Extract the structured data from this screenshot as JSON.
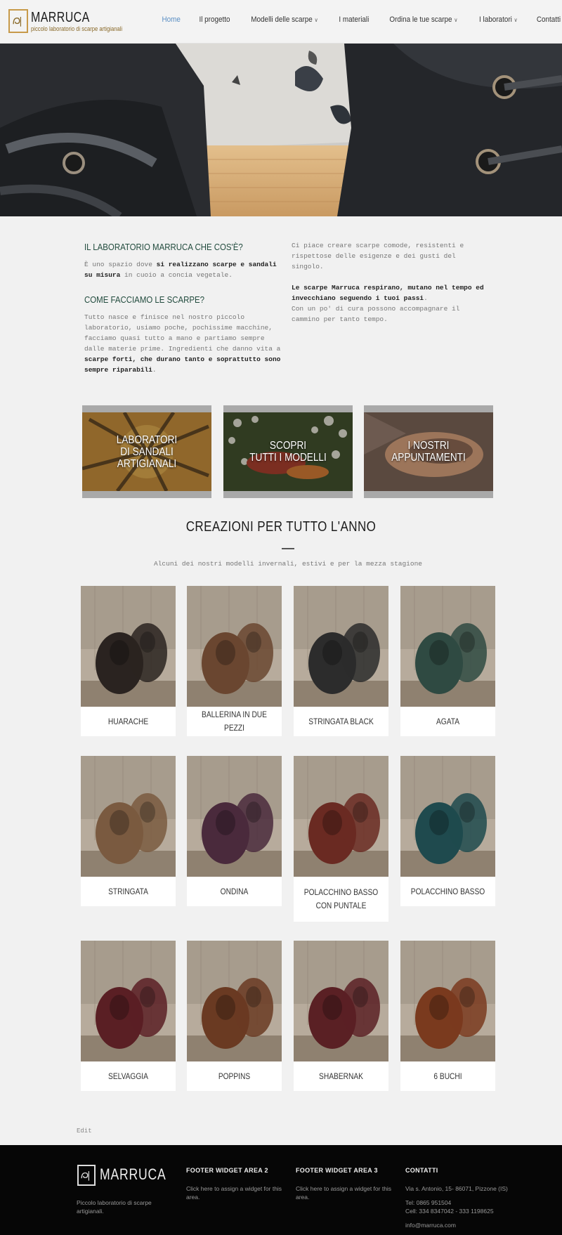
{
  "header": {
    "logo_name": "MARRUCA",
    "logo_tagline": "piccolo laboratorio di scarpe artigianali",
    "nav": [
      {
        "label": "Home",
        "active": true,
        "dropdown": false
      },
      {
        "label": "Il progetto",
        "active": false,
        "dropdown": false
      },
      {
        "label": "Modelli delle scarpe",
        "active": false,
        "dropdown": true
      },
      {
        "label": "I materiali",
        "active": false,
        "dropdown": false
      },
      {
        "label": "Ordina le tue scarpe",
        "active": false,
        "dropdown": true
      },
      {
        "label": "I laboratori",
        "active": false,
        "dropdown": true
      },
      {
        "label": "Contatti",
        "active": false,
        "dropdown": false
      }
    ]
  },
  "intro": {
    "h1": "IL LABORATORIO MARRUCA CHE COS'È?",
    "p1_a": "È uno spazio dove ",
    "p1_b": "si realizzano scarpe e sandali su misura",
    "p1_c": " in cuoio a concia vegetale.",
    "h2": "COME FACCIAMO LE SCARPE?",
    "p2_a": "Tutto nasce e finisce nel nostro piccolo laboratorio, usiamo poche, pochissime macchine, facciamo quasi tutto a mano e partiamo sempre dalle materie prime. Ingredienti che danno vita a ",
    "p2_b": "scarpe forti, che durano tanto e soprattutto sono sempre riparabili",
    "p2_c": ".",
    "r1": "Ci piace creare scarpe comode, resistenti e rispettose delle esigenze e dei gusti del singolo.",
    "r2_b": "Le scarpe Marruca respirano, mutano nel tempo ed invecchiano seguendo i tuoi passi",
    "r2_c": ".",
    "r3": "Con un po' di cura possono accompagnare il cammino per tanto tempo."
  },
  "promos": [
    {
      "line1": "LABORATORI",
      "line2": "DI SANDALI ARTIGIANALI"
    },
    {
      "line1": "SCOPRI",
      "line2": "TUTTI I MODELLI"
    },
    {
      "line1": "I NOSTRI APPUNTAMENTI",
      "line2": ""
    }
  ],
  "creations": {
    "title": "CREAZIONI PER TUTTO L'ANNO",
    "subtitle": "Alcuni dei nostri modelli invernali, estivi e per la mezza stagione",
    "products": [
      {
        "name": "HUARACHE",
        "color": "#2a2320"
      },
      {
        "name": "BALLERINA IN DUE PEZZI",
        "color": "#6a4630"
      },
      {
        "name": "STRINGATA BLACK",
        "color": "#2c2c2c"
      },
      {
        "name": "AGATA",
        "color": "#2f4a42"
      },
      {
        "name": "STRINGATA",
        "color": "#7a5a40"
      },
      {
        "name": "ONDINA",
        "color": "#4a2a3c"
      },
      {
        "name": "POLACCHINO BASSO CON PUNTALE",
        "color": "#6a2a22"
      },
      {
        "name": "POLACCHINO BASSO",
        "color": "#1f4a4e"
      },
      {
        "name": "SELVAGGIA",
        "color": "#5a1f24"
      },
      {
        "name": "POPPINS",
        "color": "#6a3a22"
      },
      {
        "name": "SHABERNAK",
        "color": "#5a2024"
      },
      {
        "name": "6 BUCHI",
        "color": "#7a3a1e"
      }
    ]
  },
  "edit_label": "Edit",
  "footer": {
    "logo_name": "MARRUCA",
    "tagline": "Piccolo laboratorio di scarpe artigianali.",
    "w2_title": "FOOTER WIDGET AREA 2",
    "w2_text": "Click here to assign a widget for this area.",
    "w3_title": "FOOTER WIDGET AREA 3",
    "w3_text": "Click here to assign a widget for this area.",
    "contacts_title": "CONTATTI",
    "address": "Via s. Antonio, 15- 86071, Pizzone (IS)",
    "tel": "Tel: 0865 951504",
    "cell": "Cell: 334 8347042 - 333 1198625",
    "email": "info@marruca.com"
  }
}
